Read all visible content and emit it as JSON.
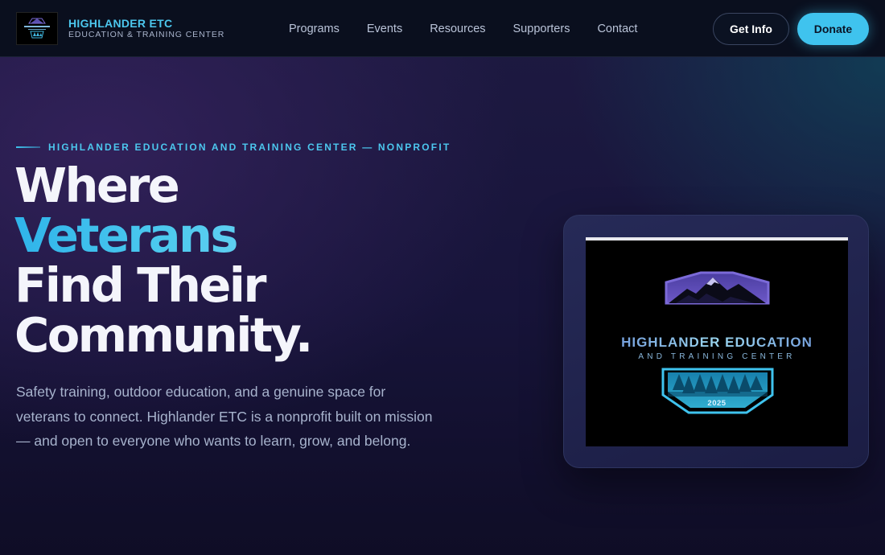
{
  "brand": {
    "title": "HIGHLANDER ETC",
    "subtitle": "EDUCATION & TRAINING CENTER",
    "logo_icon": "highlander-badge-logo"
  },
  "nav": {
    "items": [
      {
        "label": "Programs"
      },
      {
        "label": "Events"
      },
      {
        "label": "Resources"
      },
      {
        "label": "Supporters"
      },
      {
        "label": "Contact"
      }
    ]
  },
  "actions": {
    "get_info_label": "Get Info",
    "donate_label": "Donate"
  },
  "hero": {
    "eyebrow": "HIGHLANDER EDUCATION AND TRAINING CENTER — NONPROFIT",
    "headline": {
      "line1": "Where",
      "line2": "Veterans",
      "line3": "Find Their",
      "line4": "Community."
    },
    "lede": "Safety training, outdoor education, and a genuine space for veterans to connect. Highlander ETC is a nonprofit built on mission — and open to everyone who wants to learn, grow, and belong."
  },
  "hero_image": {
    "title": "HIGHLANDER EDUCATION",
    "subtitle": "AND TRAINING CENTER",
    "year": "2025",
    "icon": "mountain-and-pine-trees-badge"
  },
  "colors": {
    "accent": "#3fc3ee",
    "header_bg": "#0a0f1e",
    "page_bg": "#1a1740",
    "text_muted": "#a7b3cd"
  }
}
